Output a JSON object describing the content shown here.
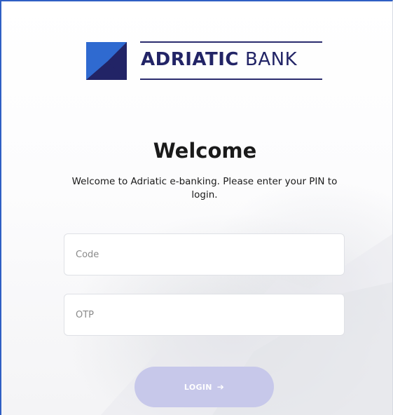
{
  "brand": {
    "name_bold": "ADRIATIC",
    "name_light": "BANK",
    "primary_color": "#222466",
    "accent_color": "#2f6ad0"
  },
  "welcome": {
    "title": "Welcome",
    "text": "Welcome to Adriatic e-banking. Please enter your PIN to login."
  },
  "form": {
    "code_placeholder": "Code",
    "otp_placeholder": "OTP",
    "login_label": "LOGIN",
    "login_icon": "arrow-right-icon",
    "button_color": "#c7c8ea"
  }
}
